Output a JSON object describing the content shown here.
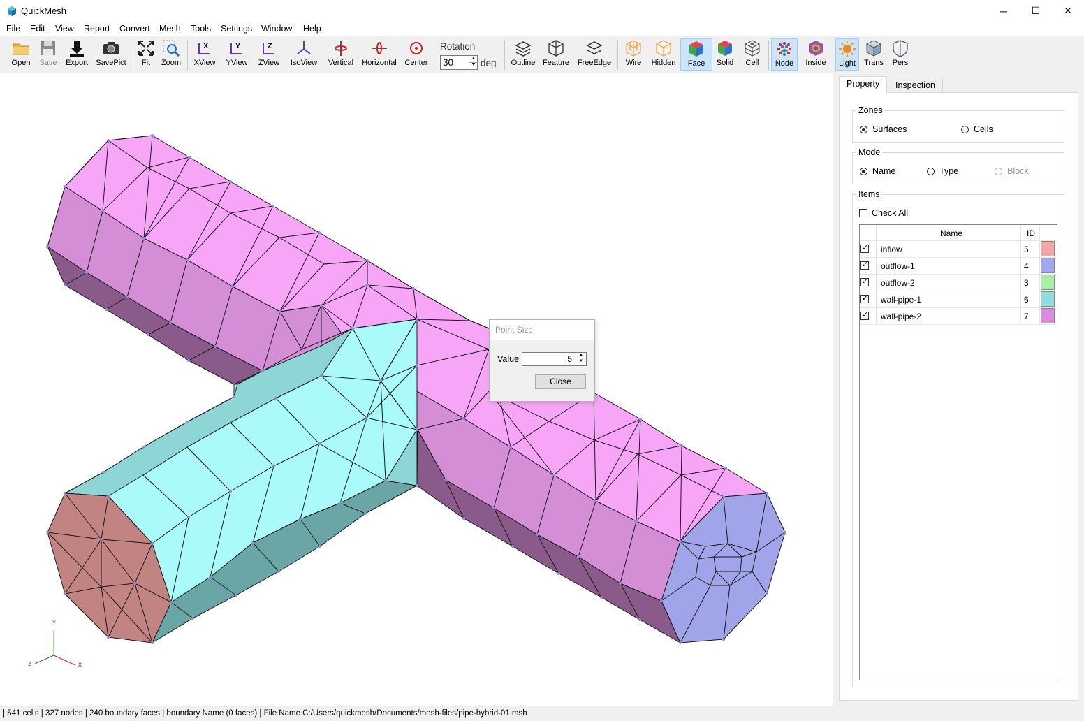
{
  "window": {
    "title": "QuickMesh",
    "controls": {
      "minimize": "─",
      "maximize": "☐",
      "close": "✕"
    }
  },
  "menu": [
    "File",
    "Edit",
    "View",
    "Report",
    "Convert",
    "Mesh",
    "Tools",
    "Settings",
    "Window",
    "Help"
  ],
  "toolbar": {
    "open": "Open",
    "save": "Save",
    "export": "Export",
    "savepict": "SavePict",
    "fit": "Fit",
    "zoom": "Zoom",
    "xview": "XView",
    "yview": "YView",
    "zview": "ZView",
    "isoview": "IsoView",
    "vertical": "Vertical",
    "horizontal": "Horizontal",
    "center": "Center",
    "rotation_label": "Rotation",
    "rotation_value": "30",
    "rotation_unit": "deg",
    "outline": "Outline",
    "feature": "Feature",
    "freeedge": "FreeEdge",
    "wire": "Wire",
    "hidden": "Hidden",
    "face": "Face",
    "solid": "Solid",
    "cell": "Cell",
    "node": "Node",
    "inside": "Inside",
    "light": "Light",
    "trans": "Trans",
    "pers": "Pers"
  },
  "axes": {
    "y": "y",
    "z": "z",
    "x": "x"
  },
  "panel": {
    "tabs": [
      "Property",
      "Inspection"
    ],
    "zones": {
      "title": "Zones",
      "surfaces": "Surfaces",
      "cells": "Cells",
      "selected": "Surfaces"
    },
    "mode": {
      "title": "Mode",
      "name": "Name",
      "type": "Type",
      "block": "Block",
      "selected": "Name"
    },
    "items": {
      "title": "Items",
      "check_all": "Check All",
      "col_name": "Name",
      "col_id": "ID",
      "rows": [
        {
          "name": "inflow",
          "id": "5",
          "color": "#f4a6a6",
          "checked": true
        },
        {
          "name": "outflow-1",
          "id": "4",
          "color": "#a3a6ec",
          "checked": true
        },
        {
          "name": "outflow-2",
          "id": "3",
          "color": "#a6f0a6",
          "checked": true
        },
        {
          "name": "wall-pipe-1",
          "id": "6",
          "color": "#8fdcdc",
          "checked": true
        },
        {
          "name": "wall-pipe-2",
          "id": "7",
          "color": "#dc8cdc",
          "checked": true
        }
      ]
    }
  },
  "dialog": {
    "title": "Point Size",
    "value_label": "Value",
    "value": "5",
    "close": "Close"
  },
  "status": "| 541 cells | 327 nodes | 240 boundary faces |  boundary Name  (0 faces) | File Name C:/Users/quickmesh/Documents/mesh-files/pipe-hybrid-01.msh"
}
